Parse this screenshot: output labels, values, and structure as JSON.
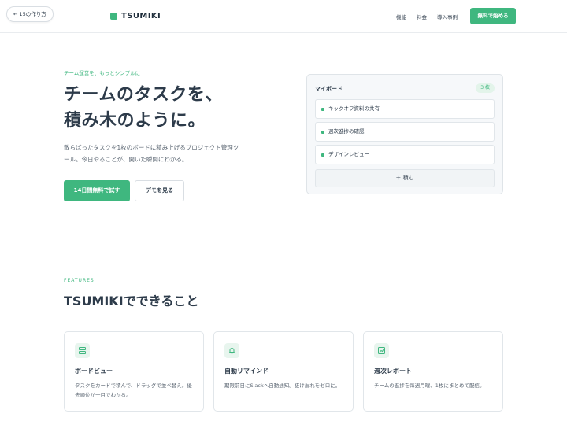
{
  "header": {
    "back_label": "← 15の作り方",
    "logo_text": "TSUMIKI",
    "nav": [
      "機能",
      "料金",
      "導入事例"
    ],
    "cta_label": "無料で始める"
  },
  "hero": {
    "eyebrow": "チーム運営を、もっとシンプルに",
    "title_lines": [
      "チームのタスクを、",
      "積み木のように。"
    ],
    "desc_lines": [
      "散らばったタスクを1枚のボードに積み上げるプロジェクト管理ツ",
      "ール。今日やることが、開いた瞬間にわかる。"
    ],
    "primary_label": "14日間無料で試す",
    "secondary_label": "デモを見る"
  },
  "board": {
    "title": "マイボード",
    "count": "3 枚",
    "cards": [
      "キックオフ資料の共有",
      "週次進捗の確認",
      "デザインレビュー"
    ],
    "add_label": "＋ 積む"
  },
  "features": {
    "eyebrow": "FEATURES",
    "title": "TSUMIKIでできること",
    "items": [
      {
        "icon": "board-icon",
        "title": "ボードビュー",
        "desc": "タスクをカードで積んで、ドラッグで並べ替え。優先順位が一目でわかる。"
      },
      {
        "icon": "bell-icon",
        "title": "自動リマインド",
        "desc": "期限前日にSlackへ自動通知。抜け漏れをゼロに。"
      },
      {
        "icon": "report-icon",
        "title": "週次レポート",
        "desc": "チームの進捗を毎週月曜、1枚にまとめて配信。"
      }
    ]
  },
  "colors": {
    "accent": "#3fb77f",
    "text": "#2d3b4a",
    "muted": "#5c6773"
  }
}
